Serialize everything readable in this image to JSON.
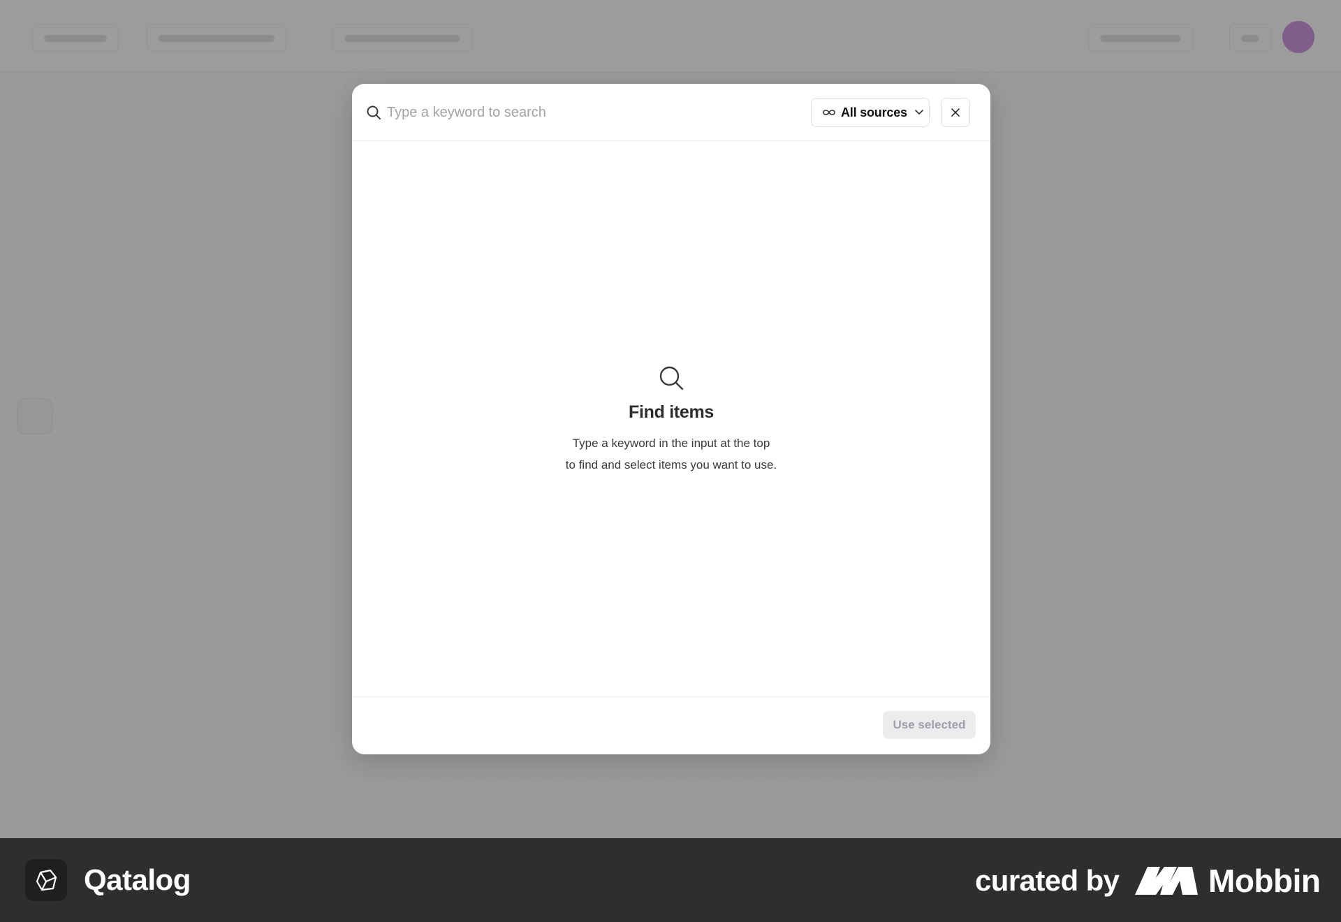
{
  "search": {
    "placeholder": "Type a keyword to search",
    "value": ""
  },
  "source_filter": {
    "selected": "All sources",
    "icon": "infinity-icon"
  },
  "close_icon": "close-icon",
  "empty_state": {
    "icon": "search-icon",
    "title": "Find items",
    "line1": "Type a keyword in the input at the top",
    "line2": "to find and select items you want to use."
  },
  "footer": {
    "use_selected_label": "Use selected",
    "use_selected_enabled": false
  },
  "brand_bar": {
    "app_name": "Qatalog",
    "curated_label": "curated by",
    "curator_name": "Mobbin"
  },
  "colors": {
    "overlay": "#606060",
    "brand_bar": "#2e2e2e",
    "avatar": "#b25ed6",
    "disabled_button_bg": "#ececee",
    "disabled_button_text": "#a0a0a6"
  }
}
